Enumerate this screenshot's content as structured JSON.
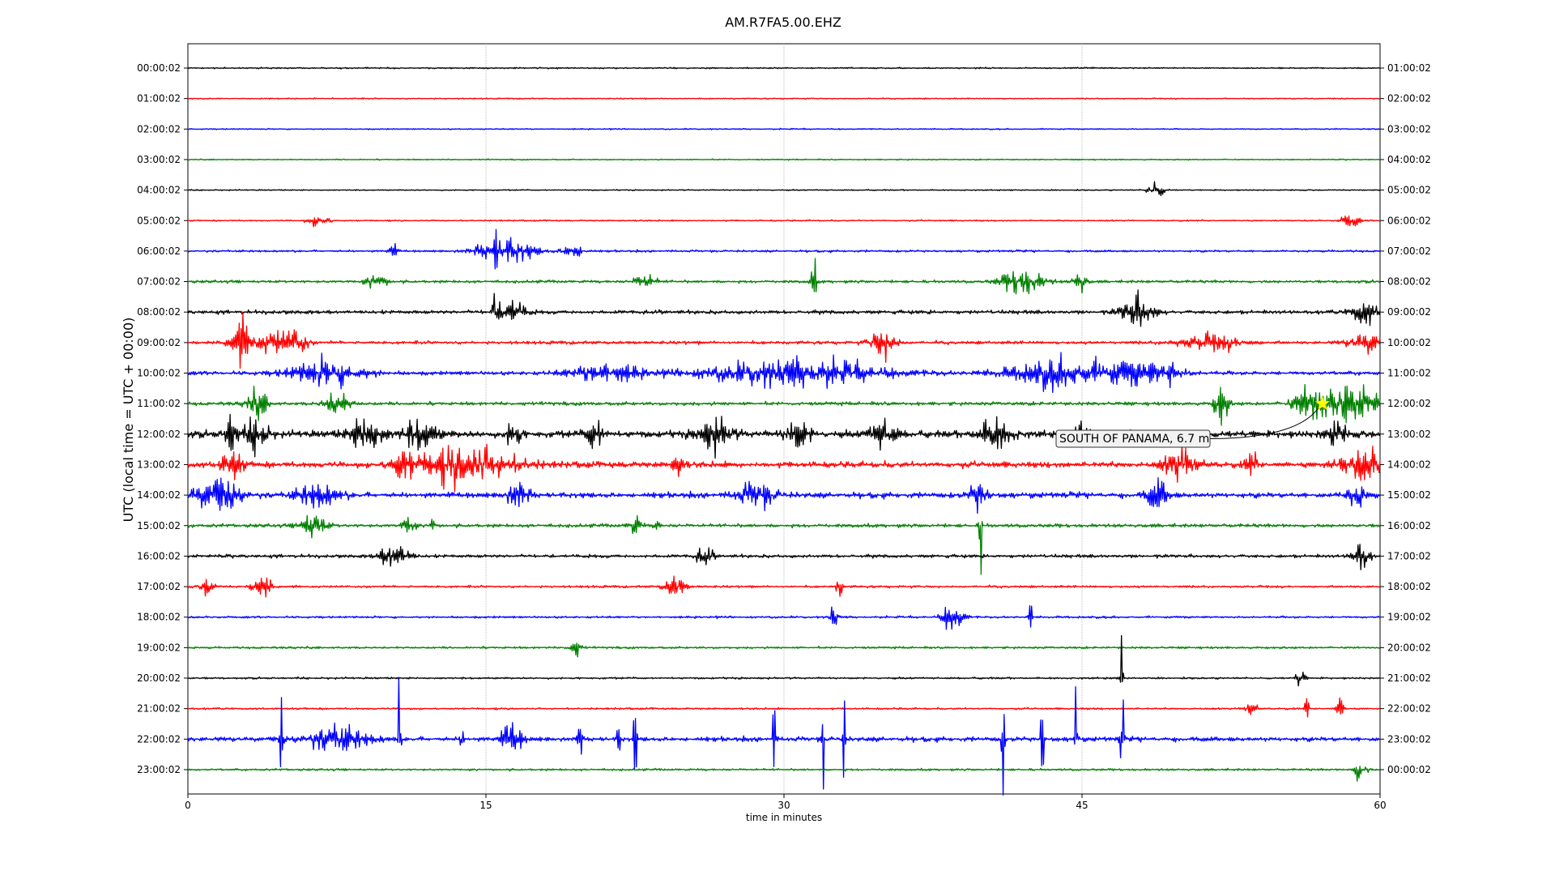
{
  "chart_data": {
    "type": "line",
    "title": "AM.R7FA5.00.EHZ",
    "xlabel": "time in minutes",
    "ylabel": "UTC (local time = UTC + 00:00)",
    "xlim": [
      0,
      60
    ],
    "x_ticks": [
      0,
      15,
      30,
      45,
      60
    ],
    "x_tick_labels": [
      "0",
      "15",
      "30",
      "45",
      "60"
    ],
    "grid": "vertical",
    "left_labels": [
      "00:00:02",
      "01:00:02",
      "02:00:02",
      "03:00:02",
      "04:00:02",
      "05:00:02",
      "06:00:02",
      "07:00:02",
      "08:00:02",
      "09:00:02",
      "10:00:02",
      "11:00:02",
      "12:00:02",
      "13:00:02",
      "14:00:02",
      "15:00:02",
      "16:00:02",
      "17:00:02",
      "18:00:02",
      "19:00:02",
      "20:00:02",
      "21:00:02",
      "22:00:02",
      "23:00:02"
    ],
    "right_labels": [
      "01:00:02",
      "02:00:02",
      "03:00:02",
      "04:00:02",
      "05:00:02",
      "06:00:02",
      "07:00:02",
      "08:00:02",
      "09:00:02",
      "10:00:02",
      "11:00:02",
      "12:00:02",
      "13:00:02",
      "14:00:02",
      "15:00:02",
      "16:00:02",
      "17:00:02",
      "18:00:02",
      "19:00:02",
      "20:00:02",
      "21:00:02",
      "22:00:02",
      "23:00:02",
      "00:00:02"
    ],
    "color_cycle": [
      "#000000",
      "#ff0000",
      "#0000ff",
      "#008000"
    ],
    "annotation": {
      "text": "SOUTH OF PANAMA, 6.7 m",
      "row": 11,
      "minute": 57.1,
      "marker": "star",
      "marker_color": "#ffff00"
    },
    "rows": [
      {
        "noise": 0.6,
        "events": []
      },
      {
        "noise": 0.5,
        "events": []
      },
      {
        "noise": 0.5,
        "events": []
      },
      {
        "noise": 0.5,
        "events": []
      },
      {
        "noise": 0.5,
        "events": [
          {
            "x": 48.7,
            "a": 9,
            "w": 0.4
          }
        ]
      },
      {
        "noise": 0.6,
        "events": [
          {
            "x": 6.6,
            "a": 6,
            "w": 0.5
          },
          {
            "x": 58.5,
            "a": 8,
            "w": 0.4
          }
        ]
      },
      {
        "noise": 0.9,
        "events": [
          {
            "x": 10.3,
            "a": 8,
            "w": 0.2
          },
          {
            "x": 16.0,
            "a": 12,
            "w": 1.4
          },
          {
            "x": 19.4,
            "a": 8,
            "w": 0.5
          },
          {
            "x": 15.5,
            "a": 30,
            "w": 0.05
          }
        ]
      },
      {
        "noise": 1.2,
        "events": [
          {
            "x": 9.5,
            "a": 7,
            "w": 0.5
          },
          {
            "x": 23.0,
            "a": 7,
            "w": 0.5
          },
          {
            "x": 31.5,
            "a": 18,
            "w": 0.15
          },
          {
            "x": 42.0,
            "a": 12,
            "w": 1.0
          },
          {
            "x": 44.9,
            "a": 11,
            "w": 0.3
          }
        ]
      },
      {
        "noise": 1.6,
        "events": [
          {
            "x": 16.2,
            "a": 12,
            "w": 0.7
          },
          {
            "x": 47.8,
            "a": 14,
            "w": 0.8
          },
          {
            "x": 59.2,
            "a": 12,
            "w": 0.6
          },
          {
            "x": 15.4,
            "a": 24,
            "w": 0.06
          }
        ]
      },
      {
        "noise": 1.4,
        "events": [
          {
            "x": 2.7,
            "a": 20,
            "w": 0.5
          },
          {
            "x": 4.5,
            "a": 12,
            "w": 1.0
          },
          {
            "x": 5.6,
            "a": 10,
            "w": 0.4
          },
          {
            "x": 35.0,
            "a": 15,
            "w": 0.6
          },
          {
            "x": 51.5,
            "a": 7,
            "w": 1.6
          },
          {
            "x": 59.5,
            "a": 9,
            "w": 1.0
          }
        ]
      },
      {
        "noise": 1.7,
        "events": [
          {
            "x": 7.0,
            "a": 12,
            "w": 1.8
          },
          {
            "x": 21.0,
            "a": 10,
            "w": 1.6
          },
          {
            "x": 30.5,
            "a": 12,
            "w": 4.2
          },
          {
            "x": 44.0,
            "a": 12,
            "w": 2.5
          },
          {
            "x": 48.0,
            "a": 10,
            "w": 1.8
          },
          {
            "x": 49.5,
            "a": 22,
            "w": 0.1
          }
        ]
      },
      {
        "noise": 1.5,
        "events": [
          {
            "x": 3.5,
            "a": 12,
            "w": 0.5
          },
          {
            "x": 7.5,
            "a": 12,
            "w": 0.6
          },
          {
            "x": 52.0,
            "a": 22,
            "w": 0.3
          },
          {
            "x": 56.5,
            "a": 16,
            "w": 0.8
          },
          {
            "x": 58.5,
            "a": 18,
            "w": 1.6
          }
        ]
      },
      {
        "noise": 3.0,
        "events": [
          {
            "x": 2.2,
            "a": 22,
            "w": 0.3
          },
          {
            "x": 3.5,
            "a": 16,
            "w": 0.5
          },
          {
            "x": 9.0,
            "a": 16,
            "w": 0.8
          },
          {
            "x": 11.7,
            "a": 14,
            "w": 0.8
          },
          {
            "x": 16.4,
            "a": 18,
            "w": 0.3
          },
          {
            "x": 20.5,
            "a": 16,
            "w": 0.4
          },
          {
            "x": 26.5,
            "a": 14,
            "w": 0.8
          },
          {
            "x": 30.7,
            "a": 14,
            "w": 0.6
          },
          {
            "x": 35.0,
            "a": 13,
            "w": 0.6
          },
          {
            "x": 40.6,
            "a": 14,
            "w": 0.8
          },
          {
            "x": 45.0,
            "a": 14,
            "w": 0.4
          },
          {
            "x": 57.7,
            "a": 12,
            "w": 0.5
          }
        ]
      },
      {
        "noise": 2.6,
        "events": [
          {
            "x": 2.2,
            "a": 14,
            "w": 0.5
          },
          {
            "x": 10.8,
            "a": 16,
            "w": 0.5
          },
          {
            "x": 14.0,
            "a": 18,
            "w": 2.4
          },
          {
            "x": 24.7,
            "a": 10,
            "w": 0.3
          },
          {
            "x": 50.0,
            "a": 15,
            "w": 0.8
          },
          {
            "x": 53.5,
            "a": 10,
            "w": 0.3
          },
          {
            "x": 59.2,
            "a": 14,
            "w": 1.2
          }
        ]
      },
      {
        "noise": 2.4,
        "events": [
          {
            "x": 1.5,
            "a": 14,
            "w": 1.2
          },
          {
            "x": 6.5,
            "a": 11,
            "w": 1.0
          },
          {
            "x": 16.6,
            "a": 14,
            "w": 0.5
          },
          {
            "x": 28.6,
            "a": 11,
            "w": 0.9
          },
          {
            "x": 39.8,
            "a": 14,
            "w": 0.4
          },
          {
            "x": 48.8,
            "a": 14,
            "w": 0.5
          },
          {
            "x": 58.8,
            "a": 11,
            "w": 0.5
          }
        ]
      },
      {
        "noise": 1.5,
        "events": [
          {
            "x": 6.3,
            "a": 12,
            "w": 0.6
          },
          {
            "x": 11.1,
            "a": 9,
            "w": 0.3
          },
          {
            "x": 12.3,
            "a": 12,
            "w": 0.1
          },
          {
            "x": 22.5,
            "a": 9,
            "w": 0.3
          },
          {
            "x": 23.6,
            "a": 10,
            "w": 0.1
          },
          {
            "x": 39.9,
            "a": 55,
            "w": 0.06
          }
        ]
      },
      {
        "noise": 1.4,
        "events": [
          {
            "x": 10.4,
            "a": 12,
            "w": 0.7
          },
          {
            "x": 26.0,
            "a": 8,
            "w": 0.4
          },
          {
            "x": 59.0,
            "a": 14,
            "w": 0.4
          }
        ]
      },
      {
        "noise": 1.0,
        "events": [
          {
            "x": 1.0,
            "a": 9,
            "w": 0.3
          },
          {
            "x": 3.5,
            "a": 10,
            "w": 0.3
          },
          {
            "x": 4.0,
            "a": 9,
            "w": 0.2
          },
          {
            "x": 24.5,
            "a": 10,
            "w": 0.5
          },
          {
            "x": 32.8,
            "a": 8,
            "w": 0.2
          }
        ]
      },
      {
        "noise": 0.9,
        "events": [
          {
            "x": 32.5,
            "a": 12,
            "w": 0.2
          },
          {
            "x": 38.5,
            "a": 14,
            "w": 0.5
          },
          {
            "x": 42.4,
            "a": 18,
            "w": 0.08
          }
        ]
      },
      {
        "noise": 0.9,
        "events": [
          {
            "x": 19.5,
            "a": 8,
            "w": 0.3
          }
        ]
      },
      {
        "noise": 0.8,
        "events": [
          {
            "x": 47.0,
            "a": 50,
            "w": 0.06
          },
          {
            "x": 56.0,
            "a": 12,
            "w": 0.2
          }
        ]
      },
      {
        "noise": 0.8,
        "events": [
          {
            "x": 53.5,
            "a": 8,
            "w": 0.3
          },
          {
            "x": 56.3,
            "a": 48,
            "w": 0.06
          },
          {
            "x": 58.0,
            "a": 12,
            "w": 0.2
          }
        ]
      },
      {
        "noise": 2.0,
        "events": [
          {
            "x": 4.7,
            "a": 40,
            "w": 0.08
          },
          {
            "x": 7.5,
            "a": 12,
            "w": 1.5
          },
          {
            "x": 10.6,
            "a": 75,
            "w": 0.08
          },
          {
            "x": 13.8,
            "a": 18,
            "w": 0.08
          },
          {
            "x": 16.3,
            "a": 14,
            "w": 0.5
          },
          {
            "x": 19.7,
            "a": 70,
            "w": 0.08
          },
          {
            "x": 21.7,
            "a": 28,
            "w": 0.08
          },
          {
            "x": 22.5,
            "a": 45,
            "w": 0.08
          },
          {
            "x": 29.5,
            "a": 48,
            "w": 0.08
          },
          {
            "x": 32.0,
            "a": 45,
            "w": 0.08
          },
          {
            "x": 33.0,
            "a": 40,
            "w": 0.08
          },
          {
            "x": 41.0,
            "a": 55,
            "w": 0.08
          },
          {
            "x": 43.0,
            "a": 55,
            "w": 0.08
          },
          {
            "x": 44.7,
            "a": 55,
            "w": 0.08
          },
          {
            "x": 47.0,
            "a": 60,
            "w": 0.08
          }
        ]
      },
      {
        "noise": 0.9,
        "events": [
          {
            "x": 59.0,
            "a": 12,
            "w": 0.3
          }
        ]
      }
    ]
  }
}
